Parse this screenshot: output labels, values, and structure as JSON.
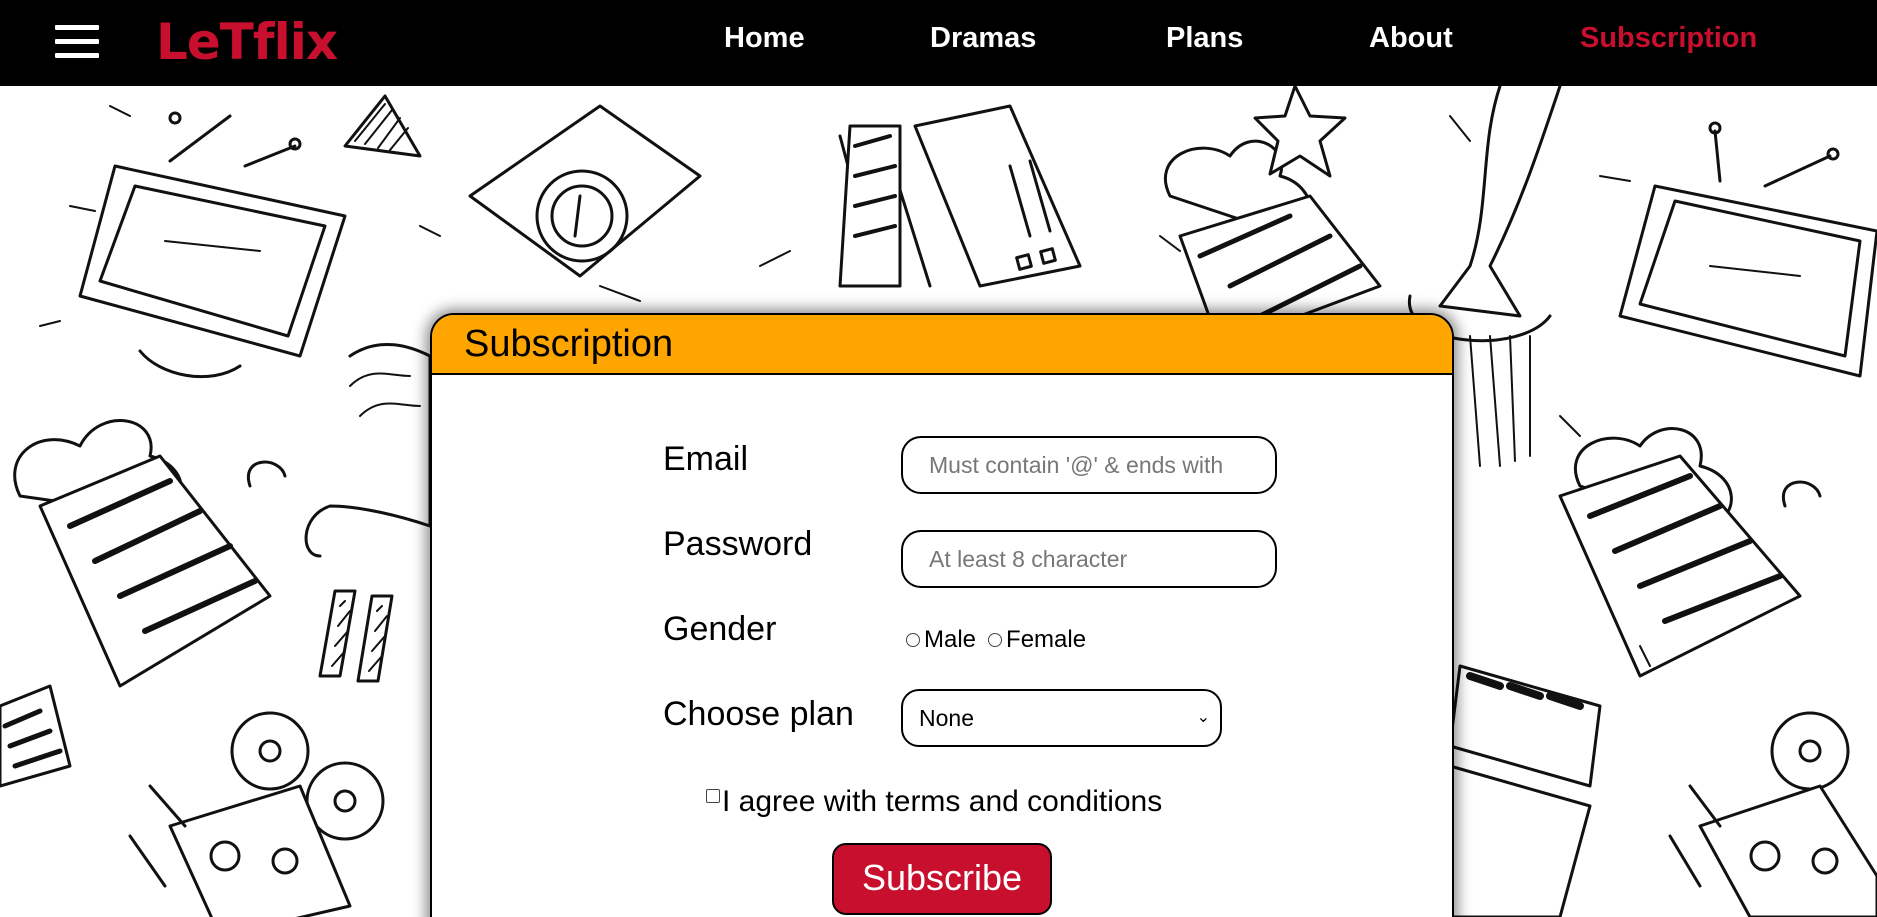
{
  "brand": {
    "logo_text": "LeTflix",
    "accent_color": "#c8102e"
  },
  "nav": {
    "menu_icon": "hamburger-menu-icon",
    "links": [
      {
        "label": "Home",
        "active": false
      },
      {
        "label": "Dramas",
        "active": false
      },
      {
        "label": "Plans",
        "active": false
      },
      {
        "label": "About",
        "active": false
      },
      {
        "label": "Subscription",
        "active": true
      }
    ]
  },
  "background": {
    "description_icons": [
      "tv-icon",
      "popcorn-icon",
      "clapperboard-icon",
      "film-projector-icon",
      "camera-icon",
      "star-icon",
      "trophy-icon"
    ]
  },
  "form": {
    "header_color": "#ffa500",
    "title": "Subscription",
    "email": {
      "label": "Email",
      "value": "",
      "placeholder": "Must contain '@' & ends with"
    },
    "password": {
      "label": "Password",
      "value": "",
      "placeholder": "At least 8 character"
    },
    "gender": {
      "label": "Gender",
      "options": [
        "Male",
        "Female"
      ],
      "selected": null
    },
    "plan": {
      "label": "Choose plan",
      "selected": "None"
    },
    "terms": {
      "label": "I agree with terms and conditions",
      "checked": false
    },
    "submit_label": "Subscribe"
  }
}
